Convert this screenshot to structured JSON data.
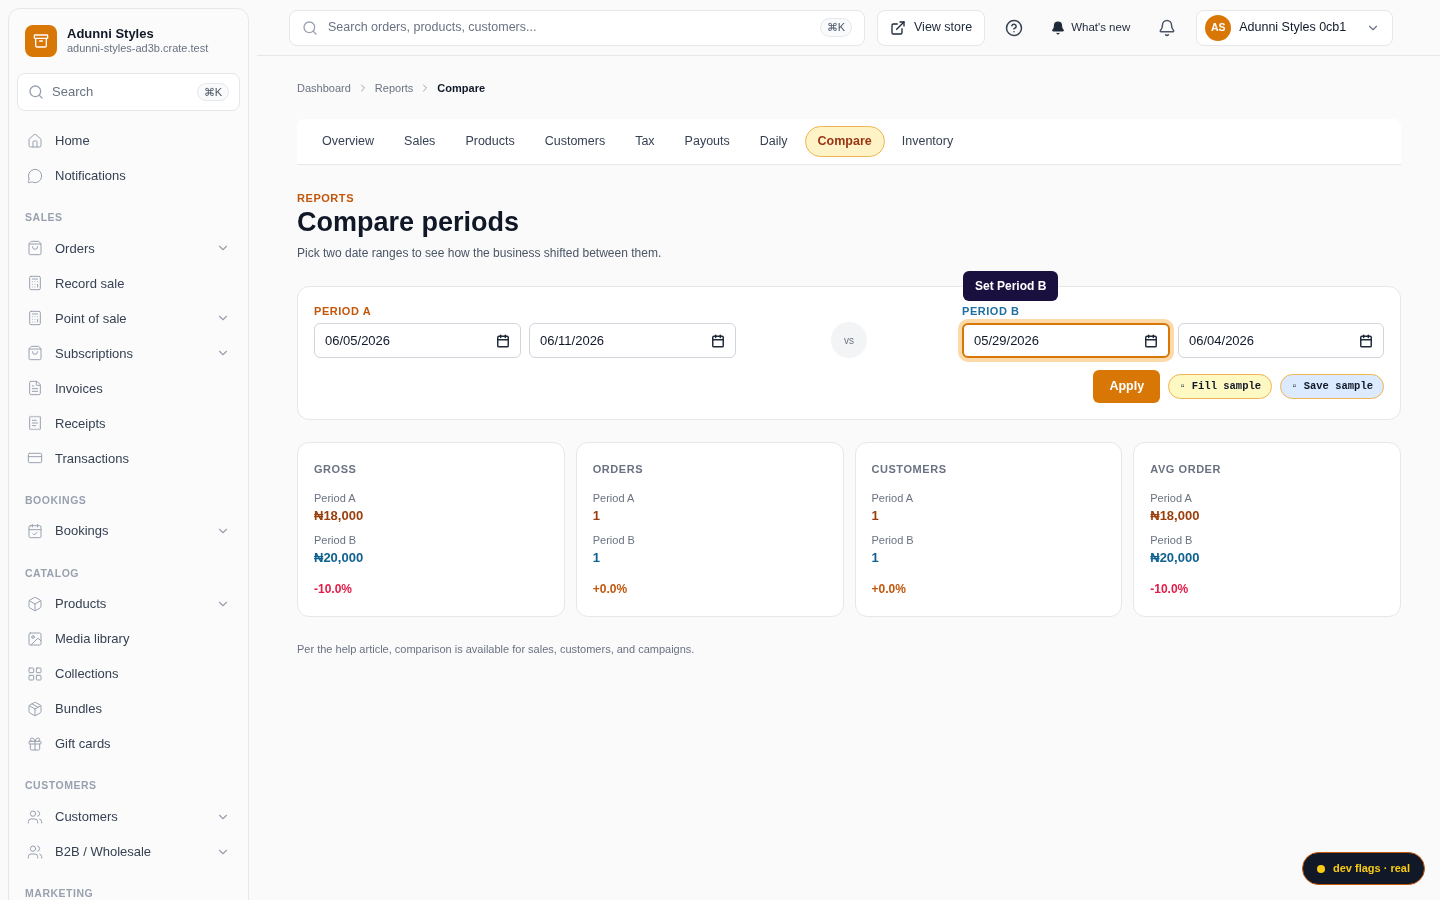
{
  "sidebar": {
    "brand": {
      "name": "Adunni Styles",
      "domain": "adunni-styles-ad3b.crate.test"
    },
    "search": {
      "placeholder": "Search",
      "shortcut": "⌘K"
    },
    "sections": [
      {
        "items": [
          {
            "label": "Home",
            "expandable": false
          },
          {
            "label": "Notifications",
            "expandable": false
          }
        ]
      },
      {
        "title": "SALES",
        "items": [
          {
            "label": "Orders",
            "expandable": true
          },
          {
            "label": "Record sale",
            "expandable": false
          },
          {
            "label": "Point of sale",
            "expandable": true
          },
          {
            "label": "Subscriptions",
            "expandable": true
          },
          {
            "label": "Invoices",
            "expandable": false
          },
          {
            "label": "Receipts",
            "expandable": false
          },
          {
            "label": "Transactions",
            "expandable": false
          }
        ]
      },
      {
        "title": "BOOKINGS",
        "items": [
          {
            "label": "Bookings",
            "expandable": true
          }
        ]
      },
      {
        "title": "CATALOG",
        "items": [
          {
            "label": "Products",
            "expandable": true
          },
          {
            "label": "Media library",
            "expandable": false
          },
          {
            "label": "Collections",
            "expandable": false
          },
          {
            "label": "Bundles",
            "expandable": false
          },
          {
            "label": "Gift cards",
            "expandable": false
          }
        ]
      },
      {
        "title": "CUSTOMERS",
        "items": [
          {
            "label": "Customers",
            "expandable": true
          },
          {
            "label": "B2B / Wholesale",
            "expandable": true
          }
        ]
      },
      {
        "title": "MARKETING"
      }
    ]
  },
  "topbar": {
    "search": {
      "placeholder": "Search orders, products, customers...",
      "shortcut": "⌘K"
    },
    "view_store": "View store",
    "whats_new": "What's new",
    "account": {
      "initials": "AS",
      "name": "Adunni Styles 0cb1"
    }
  },
  "breadcrumbs": [
    "Dashboard",
    "Reports",
    "Compare"
  ],
  "tabs": [
    {
      "label": "Overview",
      "selected": false
    },
    {
      "label": "Sales",
      "selected": false
    },
    {
      "label": "Products",
      "selected": false
    },
    {
      "label": "Customers",
      "selected": false
    },
    {
      "label": "Tax",
      "selected": false
    },
    {
      "label": "Payouts",
      "selected": false
    },
    {
      "label": "Daily",
      "selected": false
    },
    {
      "label": "Compare",
      "selected": true
    },
    {
      "label": "Inventory",
      "selected": false
    }
  ],
  "header": {
    "eyebrow": "REPORTS",
    "title": "Compare periods",
    "description": "Pick two date ranges to see how the business shifted between them."
  },
  "periods": {
    "a": {
      "label": "PERIOD A",
      "start": {
        "value": "06/05/2026",
        "focused": false
      },
      "end": {
        "value": "06/11/2026",
        "focused": false
      }
    },
    "vs": "vs",
    "b": {
      "label": "PERIOD B",
      "start": {
        "value": "05/29/2026",
        "focused": true
      },
      "end": {
        "value": "06/04/2026",
        "focused": false
      }
    },
    "tooltip": "Set Period B",
    "apply": "Apply",
    "fill_sample": "▫ Fill sample",
    "save_sample": "▫ Save sample"
  },
  "metrics": [
    {
      "title": "GROSS",
      "a_label": "Period A",
      "a_value": "₦18,000",
      "b_label": "Period B",
      "b_value": "₦20,000",
      "change": "-10.0%",
      "negative": true
    },
    {
      "title": "ORDERS",
      "a_label": "Period A",
      "a_value": "1",
      "b_label": "Period B",
      "b_value": "1",
      "change": "+0.0%",
      "negative": false
    },
    {
      "title": "CUSTOMERS",
      "a_label": "Period A",
      "a_value": "1",
      "b_label": "Period B",
      "b_value": "1",
      "change": "+0.0%",
      "negative": false
    },
    {
      "title": "AVG ORDER",
      "a_label": "Period A",
      "a_value": "₦18,000",
      "b_label": "Period B",
      "b_value": "₦20,000",
      "change": "-10.0%",
      "negative": true
    }
  ],
  "footnote": "Per the help article, comparison is available for sales, customers, and campaigns.",
  "dev_badge": "dev flags · real"
}
